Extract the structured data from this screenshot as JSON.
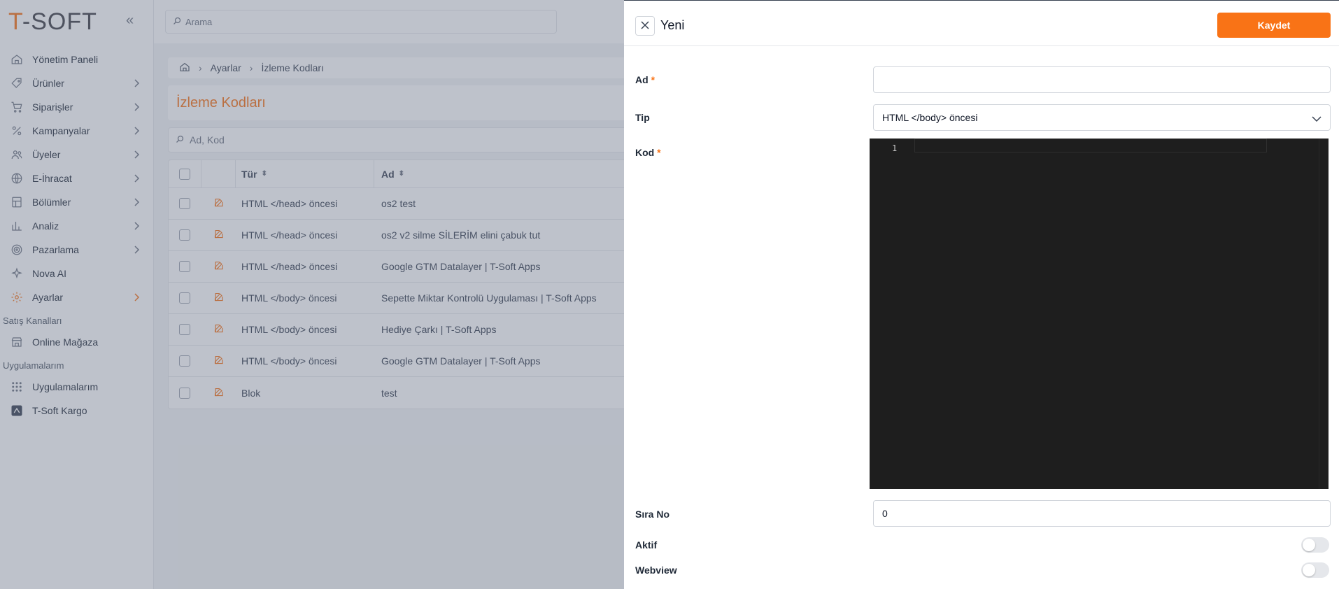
{
  "brand": {
    "logo_t": "T",
    "logo_rest": "-SOFT"
  },
  "search": {
    "placeholder": "Arama"
  },
  "sidebar": {
    "items": [
      {
        "label": "Yönetim Paneli",
        "icon": "home-icon"
      },
      {
        "label": "Ürünler",
        "icon": "tag-icon"
      },
      {
        "label": "Siparişler",
        "icon": "cart-icon"
      },
      {
        "label": "Kampanyalar",
        "icon": "percent-icon"
      },
      {
        "label": "Üyeler",
        "icon": "users-icon"
      },
      {
        "label": "E-İhracat",
        "icon": "globe-icon"
      },
      {
        "label": "Bölümler",
        "icon": "layout-icon"
      },
      {
        "label": "Analiz",
        "icon": "chart-icon"
      },
      {
        "label": "Pazarlama",
        "icon": "target-icon"
      },
      {
        "label": "Nova AI",
        "icon": "sparkle-icon"
      },
      {
        "label": "Ayarlar",
        "icon": "gear-icon"
      }
    ],
    "sales_channels_label": "Satış Kanalları",
    "online_store": "Online Mağaza",
    "apps_label": "Uygulamalarım",
    "apps_item": "Uygulamalarım",
    "cargo_item": "T-Soft Kargo"
  },
  "breadcrumb": {
    "settings": "Ayarlar",
    "current": "İzleme Kodları"
  },
  "page": {
    "title": "İzleme Kodları",
    "filter_placeholder": "Ad, Kod"
  },
  "table": {
    "headers": {
      "type": "Tür",
      "name": "Ad"
    },
    "rows": [
      {
        "type": "HTML </head> öncesi",
        "name": "os2 test"
      },
      {
        "type": "HTML </head> öncesi",
        "name": "os2 v2 silme SİLERİM elini çabuk tut"
      },
      {
        "type": "HTML </head> öncesi",
        "name": "Google GTM Datalayer | T-Soft Apps"
      },
      {
        "type": "HTML </body> öncesi",
        "name": "Sepette Miktar Kontrolü Uygulaması | T-Soft Apps"
      },
      {
        "type": "HTML </body> öncesi",
        "name": "Hediye Çarkı | T-Soft Apps"
      },
      {
        "type": "HTML </body> öncesi",
        "name": "Google GTM Datalayer | T-Soft Apps"
      },
      {
        "type": "Blok",
        "name": "test"
      }
    ]
  },
  "drawer": {
    "title": "Yeni",
    "save_label": "Kaydet",
    "name_label": "Ad",
    "required_mark": "*",
    "type_label": "Tip",
    "type_value": "HTML </body> öncesi",
    "code_label": "Kod",
    "line_number": "1",
    "order_label": "Sıra No",
    "order_value": "0",
    "active_label": "Aktif",
    "active_on": false,
    "webview_label": "Webview",
    "webview_on": false
  },
  "colors": {
    "accent": "#f97316",
    "editor_bg": "#1e1e1e"
  }
}
